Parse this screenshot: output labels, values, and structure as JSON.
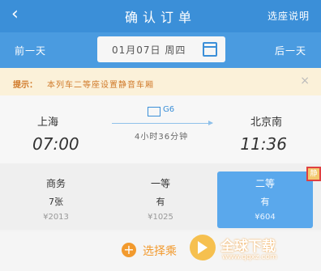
{
  "header": {
    "back_icon": "chevron-left-icon",
    "title": "确认订单",
    "help_label": "选座说明"
  },
  "datebar": {
    "prev_label": "前一天",
    "date": "01月07日 周四",
    "calendar_icon": "calendar-icon",
    "next_label": "后一天"
  },
  "notice": {
    "label": "提示：",
    "text": "本列车二等座设置静音车厢",
    "close_icon": "close-icon"
  },
  "train": {
    "from_station": "上海",
    "from_time": "07:00",
    "train_no": "G6",
    "duration": "4小时36分钟",
    "to_station": "北京南",
    "to_time": "11:36"
  },
  "seats": [
    {
      "name": "商务",
      "availability": "7张",
      "price": "¥2013",
      "selected": false
    },
    {
      "name": "一等",
      "availability": "有",
      "price": "¥1025",
      "selected": false
    },
    {
      "name": "二等",
      "availability": "有",
      "price": "¥604",
      "selected": true
    }
  ],
  "seat_badge": "静",
  "choose": {
    "plus_icon": "plus-circle-icon",
    "label": "选择乘"
  },
  "watermark": {
    "text": "全球下载",
    "url": "www.qqxz.com"
  },
  "colors": {
    "primary": "#3b8fd8",
    "accent": "#f29a2e",
    "notice_bg": "#fbf1d9"
  }
}
